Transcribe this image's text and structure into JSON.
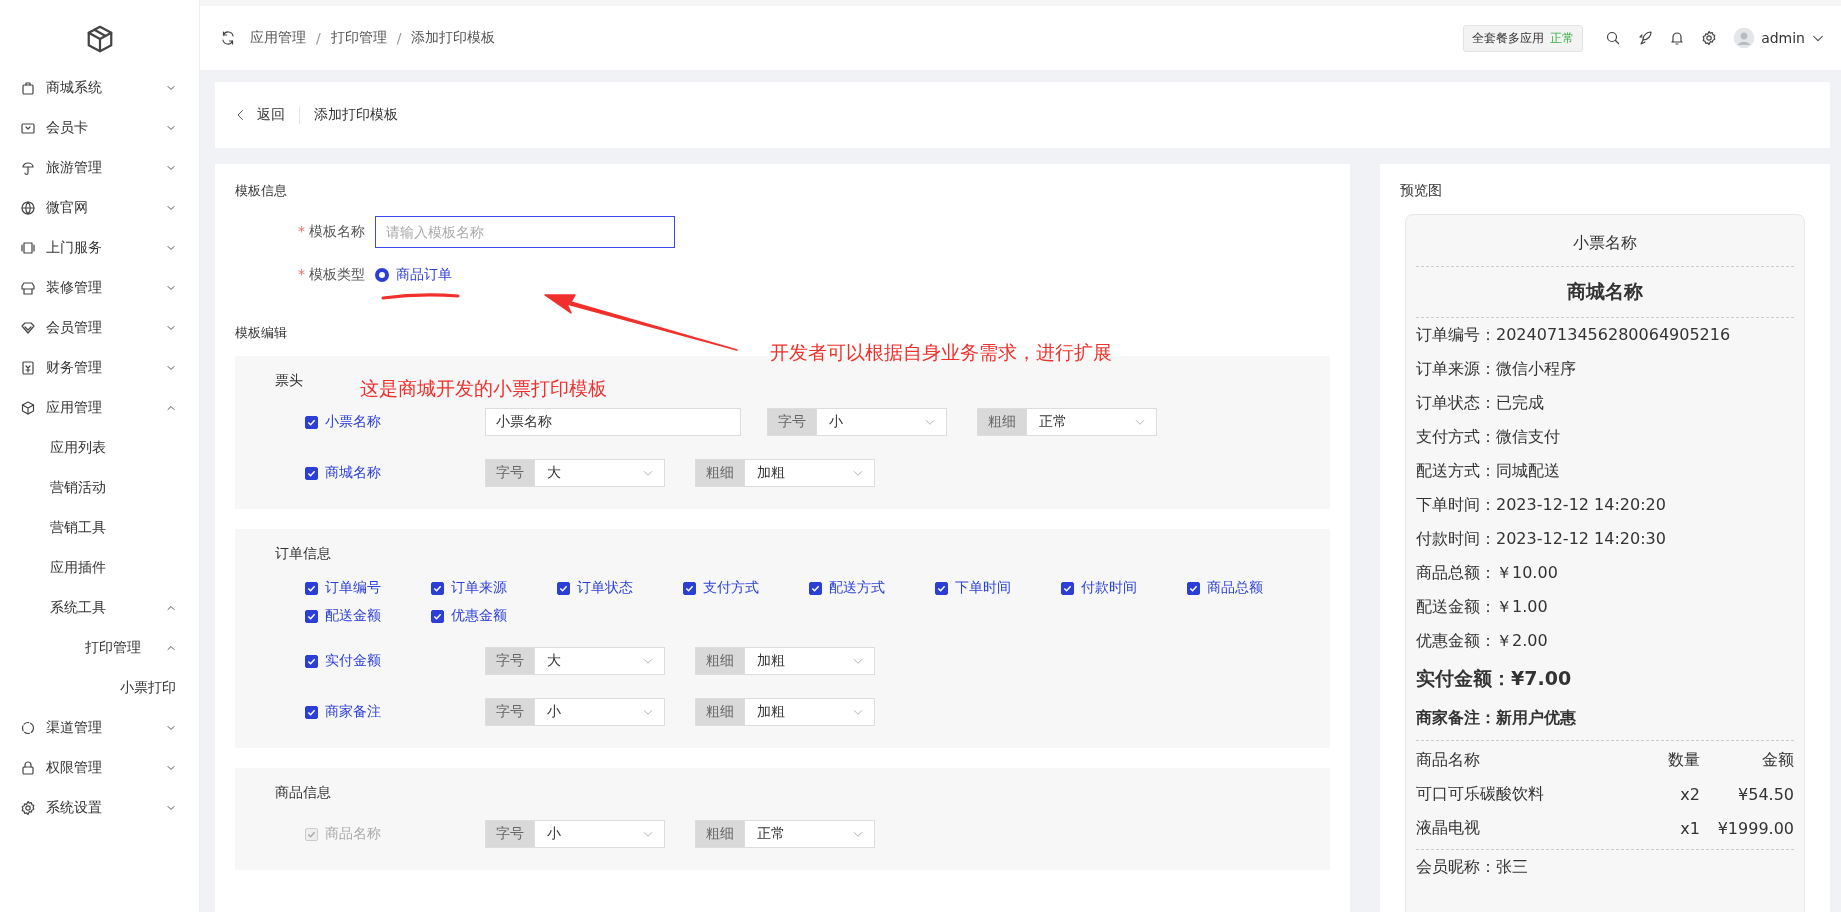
{
  "sidebar": {
    "items": [
      {
        "label": "商城系统",
        "expanded": false
      },
      {
        "label": "会员卡",
        "expanded": false
      },
      {
        "label": "旅游管理",
        "expanded": false
      },
      {
        "label": "微官网",
        "expanded": false
      },
      {
        "label": "上门服务",
        "expanded": false
      },
      {
        "label": "装修管理",
        "expanded": false
      },
      {
        "label": "会员管理",
        "expanded": false
      },
      {
        "label": "财务管理",
        "expanded": false
      },
      {
        "label": "应用管理",
        "expanded": true,
        "children": [
          {
            "label": "应用列表"
          },
          {
            "label": "营销活动"
          },
          {
            "label": "营销工具"
          },
          {
            "label": "应用插件"
          },
          {
            "label": "系统工具",
            "expanded": true,
            "children": [
              {
                "label": "打印管理",
                "expanded": true,
                "children": [
                  {
                    "label": "小票打印"
                  }
                ]
              }
            ]
          }
        ]
      },
      {
        "label": "渠道管理",
        "expanded": false
      },
      {
        "label": "权限管理",
        "expanded": false
      },
      {
        "label": "系统设置",
        "expanded": false
      }
    ]
  },
  "header": {
    "breadcrumb": [
      {
        "label": "应用管理",
        "separator": "/"
      },
      {
        "label": "打印管理",
        "separator": "/"
      },
      {
        "label": "添加打印模板"
      }
    ],
    "plan": {
      "name": "全套餐多应用",
      "status": "正常"
    },
    "user": "admin"
  },
  "page_bar": {
    "back": "返回",
    "title": "添加打印模板"
  },
  "form": {
    "section_title": "模板信息",
    "name_field": {
      "label": "模板名称",
      "required_mark": "*",
      "placeholder": "请输入模板名称"
    },
    "type_field": {
      "label": "模板类型",
      "required_mark": "*",
      "options": [
        {
          "label": "商品订单",
          "selected": true
        }
      ]
    },
    "editor_title": "模板编辑",
    "sections": [
      {
        "title": "票头",
        "rows": [
          {
            "label": "小票名称",
            "checked": true,
            "disabled": false,
            "value": "小票名称",
            "size": {
              "label": "字号",
              "value": "小"
            },
            "weight": {
              "label": "粗细",
              "value": "正常"
            }
          },
          {
            "label": "商城名称",
            "checked": true,
            "disabled": false,
            "size": {
              "label": "字号",
              "value": "大"
            },
            "weight": {
              "label": "粗细",
              "value": "加粗"
            }
          }
        ]
      },
      {
        "title": "订单信息",
        "checks": [
          {
            "label": "订单编号",
            "checked": true
          },
          {
            "label": "订单来源",
            "checked": true
          },
          {
            "label": "订单状态",
            "checked": true
          },
          {
            "label": "支付方式",
            "checked": true
          },
          {
            "label": "配送方式",
            "checked": true
          },
          {
            "label": "下单时间",
            "checked": true
          },
          {
            "label": "付款时间",
            "checked": true
          },
          {
            "label": "商品总额",
            "checked": true
          },
          {
            "label": "配送金额",
            "checked": true
          },
          {
            "label": "优惠金额",
            "checked": true
          }
        ],
        "rows": [
          {
            "label": "实付金额",
            "checked": true,
            "disabled": false,
            "size": {
              "label": "字号",
              "value": "大"
            },
            "weight": {
              "label": "粗细",
              "value": "加粗"
            }
          },
          {
            "label": "商家备注",
            "checked": true,
            "disabled": false,
            "size": {
              "label": "字号",
              "value": "小"
            },
            "weight": {
              "label": "粗细",
              "value": "加粗"
            }
          }
        ]
      },
      {
        "title": "商品信息",
        "rows": [
          {
            "label": "商品名称",
            "checked": true,
            "disabled": true,
            "size": {
              "label": "字号",
              "value": "小"
            },
            "weight": {
              "label": "粗细",
              "value": "正常"
            }
          }
        ]
      }
    ],
    "annotations": [
      "开发者可以根据自身业务需求，进行扩展",
      "这是商城开发的小票打印模板"
    ]
  },
  "preview": {
    "title": "预览图",
    "receipt": {
      "ticket_name": "小票名称",
      "shop_name": "商城名称",
      "lines": [
        {
          "label": "订单编号：",
          "value": "20240713456280064905216"
        },
        {
          "label": "订单来源：",
          "value": "微信小程序"
        },
        {
          "label": "订单状态：",
          "value": "已完成"
        },
        {
          "label": "支付方式：",
          "value": "微信支付"
        },
        {
          "label": "配送方式：",
          "value": "同城配送"
        },
        {
          "label": "下单时间：",
          "value": "2023-12-12 14:20:20"
        },
        {
          "label": "付款时间：",
          "value": "2023-12-12 14:20:30"
        },
        {
          "label": "商品总额：",
          "value": "￥10.00"
        },
        {
          "label": "配送金额：",
          "value": "￥1.00"
        },
        {
          "label": "优惠金额：",
          "value": "￥2.00"
        }
      ],
      "total": {
        "label": "实付金额：",
        "value": "¥7.00"
      },
      "remark": {
        "label": "商家备注：",
        "value": "新用户优惠"
      },
      "table": {
        "columns": [
          "商品名称",
          "数量",
          "金额"
        ],
        "rows": [
          [
            "可口可乐碳酸饮料",
            "x2",
            "¥54.50"
          ],
          [
            "液晶电视",
            "x1",
            "¥1999.00"
          ]
        ]
      },
      "member": {
        "label": "会员昵称：",
        "value": "张三"
      }
    }
  }
}
